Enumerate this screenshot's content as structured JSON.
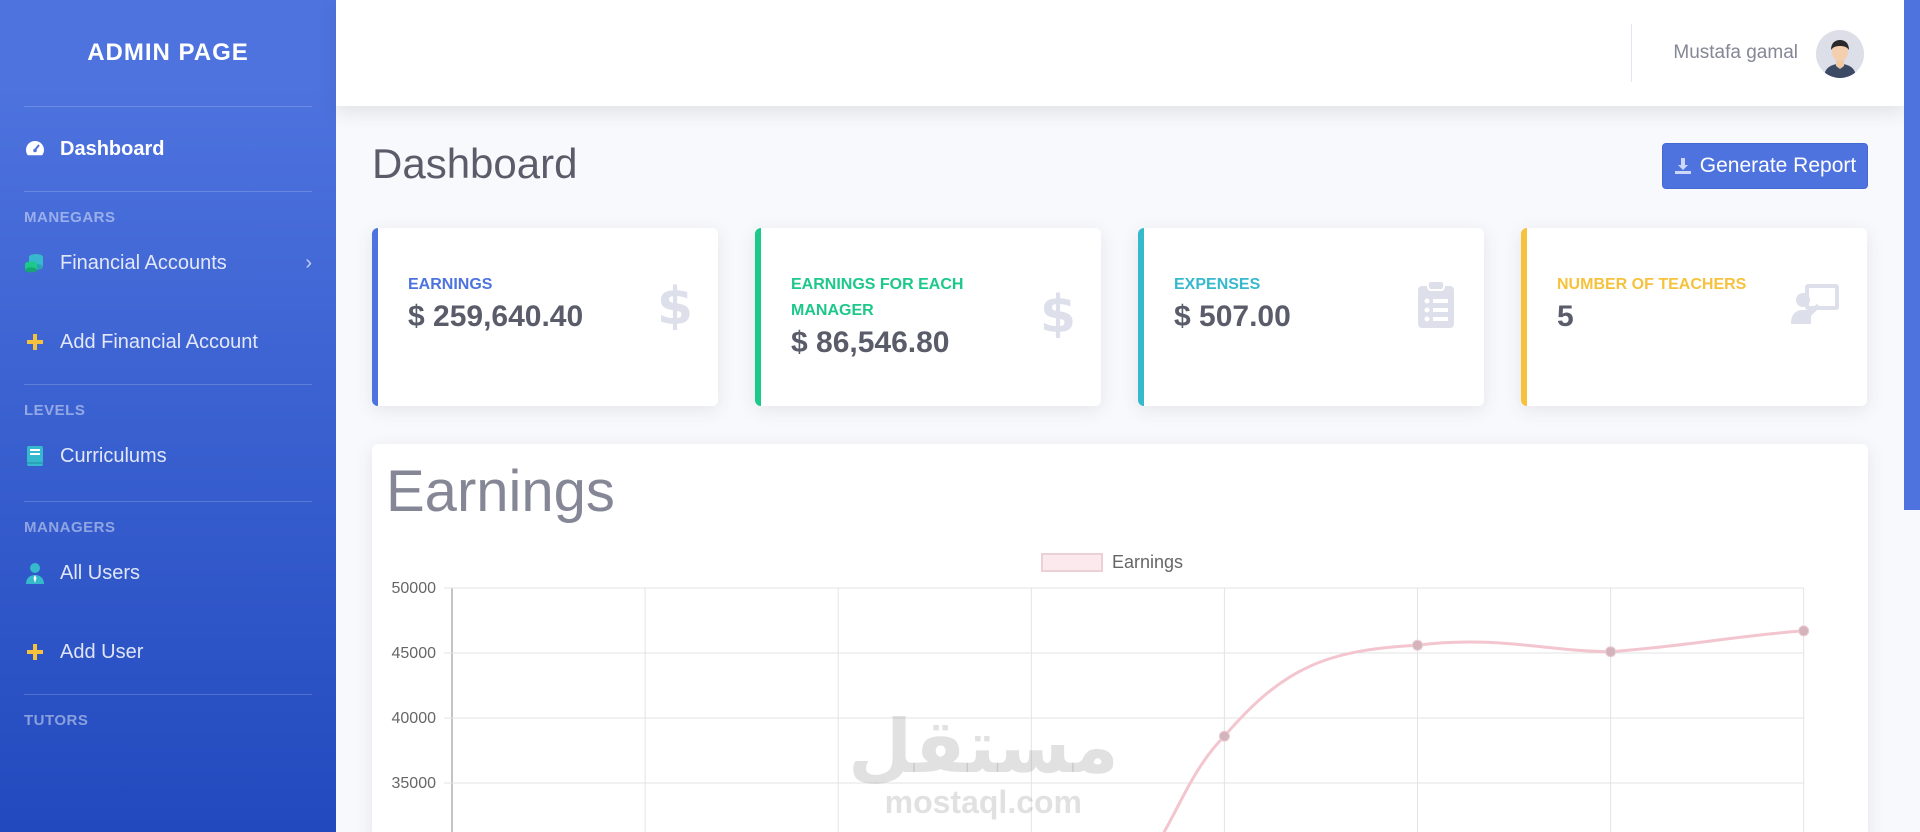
{
  "sidebar": {
    "brand": "ADMIN PAGE",
    "dashboard": "Dashboard",
    "heading_managers_1": "MANEGARS",
    "financial_accounts": "Financial Accounts",
    "add_financial_account": "Add Financial Account",
    "heading_levels": "LEVELS",
    "curriculums": "Curriculums",
    "heading_managers_2": "MANAGERS",
    "all_users": "All Users",
    "add_user": "Add User",
    "heading_tutors": "TUTORS"
  },
  "topbar": {
    "user_name": "Mustafa gamal"
  },
  "page": {
    "title": "Dashboard",
    "generate_report": "Generate Report"
  },
  "cards": [
    {
      "label": "EARNINGS",
      "value": "$ 259,640.40",
      "color": "#4e73df",
      "icon": "dollar-icon"
    },
    {
      "label": "EARNINGS FOR EACH MANAGER",
      "value": "$ 86,546.80",
      "color": "#1cc88a",
      "icon": "dollar-icon"
    },
    {
      "label": "EXPENSES",
      "value": "$ 507.00",
      "color": "#36b9cc",
      "icon": "clipboard-list-icon"
    },
    {
      "label": "NUMBER OF TEACHERS",
      "value": "5",
      "color": "#f6c23e",
      "icon": "chalkboard-teacher-icon"
    }
  ],
  "chart_card": {
    "title": "Earnings"
  },
  "chart_data": {
    "type": "line",
    "legend": "Earnings",
    "ylim": [
      30000,
      50000
    ],
    "yticks": [
      "50000",
      "45000",
      "40000",
      "35000"
    ],
    "points": [
      {
        "index": 4,
        "value": 38600
      },
      {
        "index": 5,
        "value": 45600
      },
      {
        "index": 6,
        "value": 45100
      },
      {
        "index": 7,
        "value": 46700
      }
    ],
    "line_color": "#f3c5cf",
    "point_color": "#d4b3bb"
  },
  "watermark": {
    "arabic": "مستقل",
    "latin": "mostaql.com"
  }
}
